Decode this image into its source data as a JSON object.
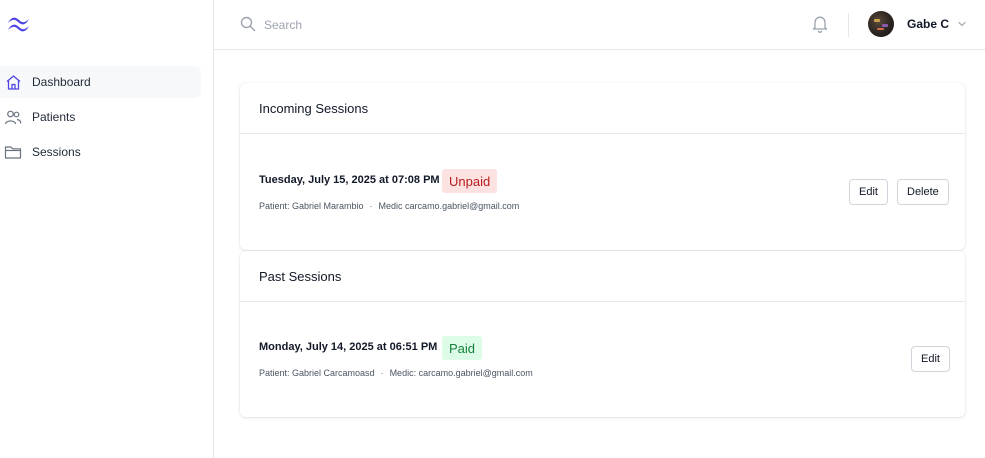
{
  "colors": {
    "accent": "#4f46e5",
    "unpaid_bg": "#fde2e2",
    "unpaid_text": "#b91c1c",
    "paid_bg": "#dcfce7",
    "paid_text": "#15803d"
  },
  "sidebar": {
    "logo_icon": "tailwind-logo",
    "items": [
      {
        "label": "Dashboard",
        "icon": "home-icon",
        "active": true
      },
      {
        "label": "Patients",
        "icon": "users-icon",
        "active": false
      },
      {
        "label": "Sessions",
        "icon": "folder-icon",
        "active": false
      }
    ]
  },
  "header": {
    "search": {
      "placeholder": "Search",
      "value": ""
    },
    "notifications_icon": "bell-icon",
    "user": {
      "name": "Gabe C"
    }
  },
  "incoming": {
    "title": "Incoming Sessions",
    "sessions": [
      {
        "date": "Tuesday, July 15, 2025 at 07:08 PM",
        "status": "Unpaid",
        "patient": "Patient: Gabriel Marambio",
        "separator": "·",
        "medic": "Medic carcamo.gabriel@gmail.com",
        "edit_label": "Edit",
        "delete_label": "Delete"
      }
    ]
  },
  "past": {
    "title": "Past Sessions",
    "sessions": [
      {
        "date": "Monday, July 14, 2025 at 06:51 PM",
        "status": "Paid",
        "patient": "Patient: Gabriel Carcamoasd",
        "separator": "·",
        "medic": "Medic: carcamo.gabriel@gmail.com",
        "edit_label": "Edit"
      }
    ]
  }
}
